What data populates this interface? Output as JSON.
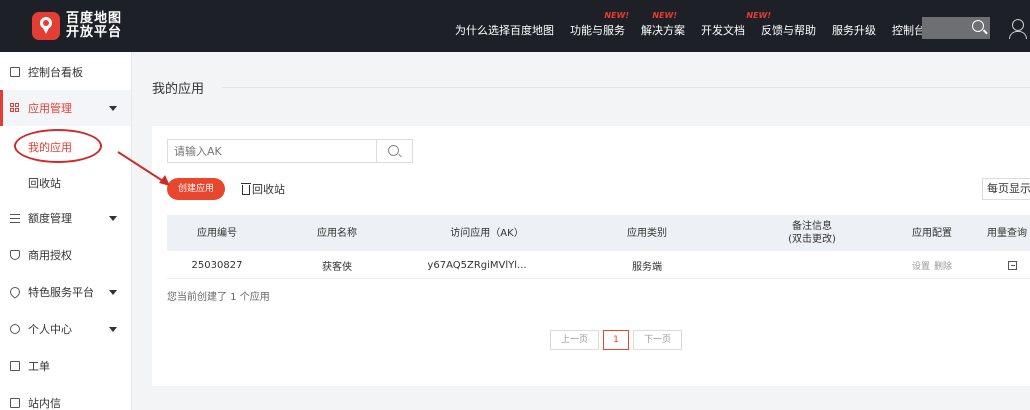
{
  "brand": {
    "line1": "百度地图",
    "line2": "开放平台"
  },
  "nav": [
    {
      "label": "为什么选择百度地图",
      "badge": ""
    },
    {
      "label": "功能与服务",
      "badge": "NEW!"
    },
    {
      "label": "解决方案",
      "badge": ""
    },
    {
      "label": "开发文档",
      "badge": "NEW!"
    },
    {
      "label": "反馈与帮助",
      "badge": ""
    },
    {
      "label": "服务升级",
      "badge": ""
    },
    {
      "label": "控制台",
      "badge": ""
    }
  ],
  "sidebar": {
    "items": [
      {
        "label": "控制台看板",
        "icon": "dashboard-icon"
      },
      {
        "label": "应用管理",
        "icon": "grid-icon"
      },
      {
        "label": "额度管理",
        "icon": "sliders-icon"
      },
      {
        "label": "商用授权",
        "icon": "shield-icon"
      },
      {
        "label": "特色服务平台",
        "icon": "heart-icon"
      },
      {
        "label": "个人中心",
        "icon": "person-icon"
      },
      {
        "label": "工单",
        "icon": "document-icon"
      },
      {
        "label": "站内信",
        "icon": "mail-icon"
      }
    ],
    "sub": {
      "my_apps": "我的应用",
      "recycle": "回收站"
    }
  },
  "main": {
    "title": "我的应用",
    "search_placeholder": "请输入AK",
    "create_button": "创建应用",
    "recycle_link": "回收站",
    "per_page": "每页显示",
    "columns": [
      "应用编号",
      "应用名称",
      "访问应用（AK）",
      "应用类别",
      "备注信息\n(双击更改)",
      "应用配置",
      "用量查询"
    ],
    "rows": [
      {
        "id": "25030827",
        "name": "获客侠",
        "ak": "y67AQ5ZRgiMVlYl...",
        "category": "服务端",
        "note": "",
        "config": [
          "设置",
          "删除"
        ]
      }
    ],
    "count_text": "您当前创建了 1 个应用",
    "pager": {
      "prev": "上一页",
      "current": "1",
      "next": "下一页"
    }
  },
  "colors": {
    "accent": "#e33e33",
    "topbar": "#1d2027",
    "table_header": "#edf0f5"
  }
}
